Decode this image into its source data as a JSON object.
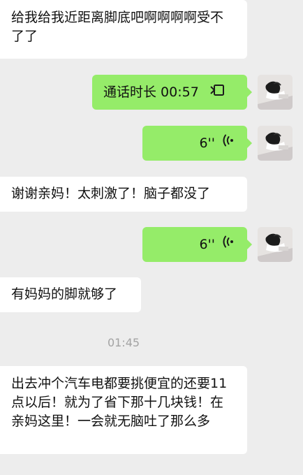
{
  "messages": {
    "m1": "给我给我近距离脚底吧啊啊啊啊受不了了",
    "call_label": "通话时长 00:57",
    "voice1": "6''",
    "m2": "谢谢亲妈！太刺激了！脑子都没了",
    "voice2": "6''",
    "m3": "有妈妈的脚就够了",
    "timestamp": "01:45",
    "m4": "出去冲个汽车电都要挑便宜的还要11点以后！就为了省下那十几块钱！在亲妈这里！一会就无脑吐了那么多"
  },
  "icons": {
    "call": "video-call-icon",
    "voice": "voice-wave-icon",
    "avatar": "user-avatar"
  },
  "colors": {
    "background": "#ededed",
    "incoming_bubble": "#ffffff",
    "outgoing_bubble": "#95ec69",
    "timestamp": "#a3a3a3"
  }
}
